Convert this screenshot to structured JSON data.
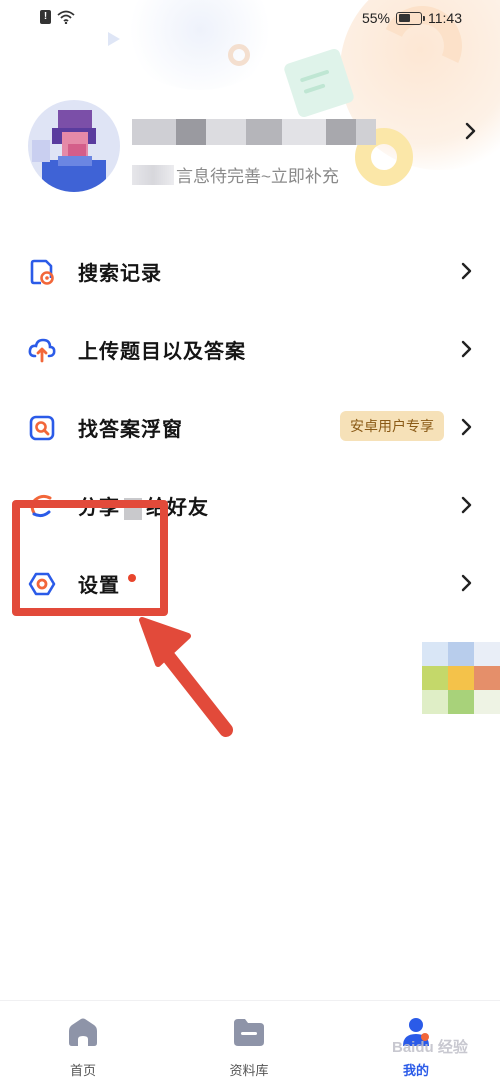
{
  "status_bar": {
    "battery_percent": "55%",
    "time": "11:43",
    "battery_level": 0.55
  },
  "profile": {
    "subtitle": "言息待完善~立即补充"
  },
  "menu": {
    "items": [
      {
        "label": "搜索记录",
        "icon": "search-history-icon"
      },
      {
        "label": "上传题目以及答案",
        "icon": "upload-cloud-icon"
      },
      {
        "label": "找答案浮窗",
        "icon": "find-answer-window-icon",
        "badge": "安卓用户专享"
      },
      {
        "label_before": "分享",
        "label_after": "给好友",
        "icon": "share-icon"
      },
      {
        "label": "设置",
        "icon": "settings-icon",
        "has_red_dot": true
      }
    ]
  },
  "bottom_nav": {
    "items": [
      {
        "label": "首页",
        "icon": "home-icon",
        "active": false
      },
      {
        "label": "资料库",
        "icon": "folder-icon",
        "active": false
      },
      {
        "label": "我的",
        "icon": "profile-icon",
        "active": true
      }
    ]
  },
  "watermark": "Baidu 经验",
  "colors": {
    "accent": "#2b5be8",
    "icon_orange": "#f2673a",
    "annotation_red": "#e24a3a",
    "badge_bg": "#f6e1b8",
    "badge_text": "#8a5a16"
  }
}
